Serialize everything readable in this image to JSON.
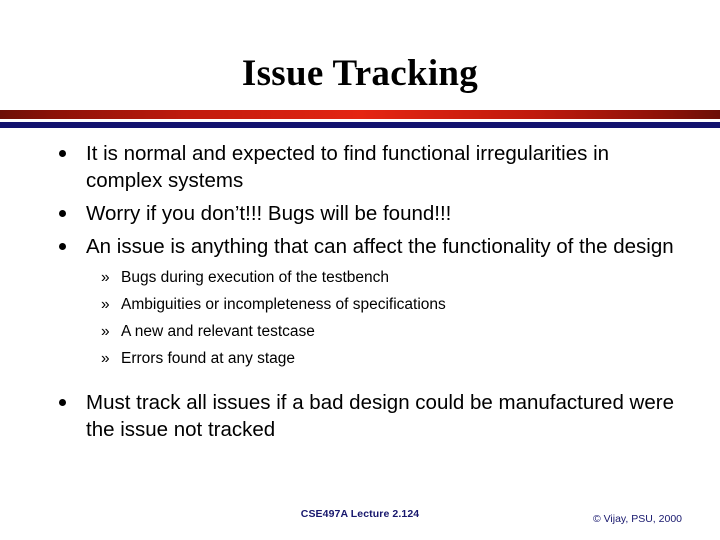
{
  "slide": {
    "title": "Issue Tracking",
    "background_color": "#ffffff",
    "title_color": "#000000"
  },
  "divider": {
    "red_edge_color": "#6d0f07",
    "red_center_color": "#e42512",
    "blue_color": "#13136f"
  },
  "content": {
    "bullets": [
      {
        "level": 1,
        "marker": "bullet-dot",
        "text": "It is normal and expected to find functional irregularities in complex systems"
      },
      {
        "level": 1,
        "marker": "bullet-dot",
        "text": "Worry if you don’t!!!  Bugs will be found!!!"
      },
      {
        "level": 1,
        "marker": "bullet-dot",
        "text": "An issue is anything that can affect the functionality of the design"
      }
    ],
    "sub_bullets": [
      {
        "level": 2,
        "marker": "»",
        "text": "Bugs during execution of the testbench"
      },
      {
        "level": 2,
        "marker": "»",
        "text": "Ambiguities or incompleteness of specifications"
      },
      {
        "level": 2,
        "marker": "»",
        "text": "A new and relevant testcase"
      },
      {
        "level": 2,
        "marker": "»",
        "text": "Errors found at any stage"
      }
    ],
    "final_bullet": {
      "level": 1,
      "marker": "bullet-dot",
      "text": "Must track all issues if a bad design could be manufactured were the issue not tracked"
    }
  },
  "footer": {
    "center": "CSE497A Lecture 2.124",
    "right": "© Vijay, PSU, 2000",
    "color": "#17176d"
  }
}
